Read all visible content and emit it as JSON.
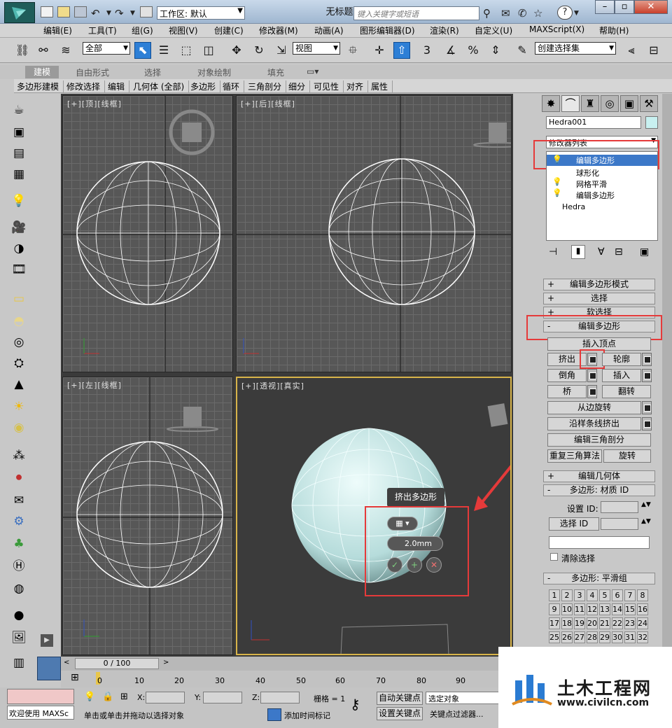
{
  "titlebar": {
    "workspace_label": "工作区:",
    "workspace_value": "默认",
    "window_title": "无标题",
    "search_placeholder": "键入关键字或短语"
  },
  "menubar": [
    "编辑(E)",
    "工具(T)",
    "组(G)",
    "视图(V)",
    "创建(C)",
    "修改器(M)",
    "动画(A)",
    "图形编辑器(D)",
    "渲染(R)",
    "自定义(U)",
    "MAXScript(X)",
    "帮助(H)"
  ],
  "toolbar": {
    "selection_filter": "全部",
    "ref_coord": "视图",
    "named_selection": "创建选择集",
    "snap_label": "3"
  },
  "ribbon": {
    "tabs": [
      "建模",
      "自由形式",
      "选择",
      "对象绘制",
      "填充"
    ],
    "active_tab": "建模",
    "tools": [
      "多边形建模",
      "修改选择",
      "编辑",
      "几何体 (全部)",
      "多边形",
      "循环",
      "三角剖分",
      "细分",
      "可见性",
      "对齐",
      "属性"
    ]
  },
  "viewports": {
    "top": "[+][顶][线框]",
    "front": "[+][后][线框]",
    "left": "[+][左][线框]",
    "persp": "[+][透视][真实]"
  },
  "caddy": {
    "title": "挤出多边形",
    "value": "2.0mm"
  },
  "timeline": {
    "frame_display": "0 / 100",
    "ticks": [
      "0",
      "10",
      "20",
      "30",
      "40",
      "50",
      "60",
      "70",
      "80",
      "90"
    ]
  },
  "command_panel": {
    "object_name": "Hedra001",
    "color": "#c8f0f0",
    "modifier_list": "修改器列表",
    "stack": [
      "编辑多边形",
      "球形化",
      "网格平滑",
      "编辑多边形",
      "Hedra"
    ],
    "rollouts": {
      "edit_poly_mode": "编辑多边形模式",
      "selection": "选择",
      "soft_selection": "软选择",
      "edit_polygons": "编辑多边形",
      "edit_geometry": "编辑几何体",
      "material_id": "多边形: 材质 ID",
      "smoothing_groups": "多边形: 平滑组"
    },
    "buttons": {
      "insert_vertex": "插入顶点",
      "extrude": "挤出",
      "outline": "轮廓",
      "bevel": "倒角",
      "inset": "插入",
      "bridge": "桥",
      "flip": "翻转",
      "hinge": "从边旋转",
      "extrude_spline": "沿样条线挤出",
      "edit_tri": "编辑三角剖分",
      "retriangulate": "重复三角算法",
      "turn": "旋转"
    },
    "set_id": "设置 ID:",
    "select_id": "选择 ID",
    "clear_selection": "清除选择",
    "smoothing": [
      "1",
      "2",
      "3",
      "4",
      "5",
      "6",
      "7",
      "8",
      "9",
      "10",
      "11",
      "12",
      "13",
      "14",
      "15",
      "16",
      "17",
      "18",
      "19",
      "20",
      "21",
      "22",
      "23",
      "24",
      "25",
      "26",
      "27",
      "28",
      "29",
      "30",
      "31",
      "32"
    ]
  },
  "status": {
    "welcome": "欢迎使用 MAXSc",
    "prompt": "单击或单击并拖动以选择对象",
    "add_tag": "添加时间标记",
    "x": "X:",
    "y": "Y:",
    "z": "Z:",
    "grid": "栅格 = 1",
    "auto_key": "自动关键点",
    "set_key": "设置关键点",
    "selected": "选定对象",
    "key_filter": "关键点过滤器..."
  },
  "brand": {
    "name": "土木工程网",
    "url": "www.civilcn.com"
  }
}
